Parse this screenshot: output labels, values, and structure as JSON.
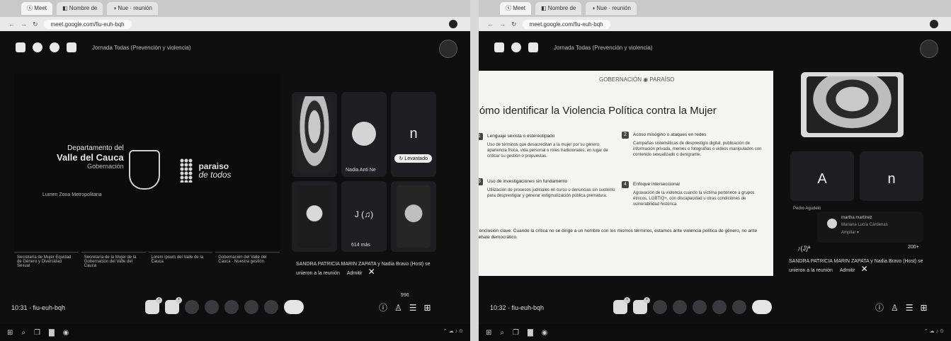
{
  "left": {
    "tabs": [
      "ⓢ Meet",
      "◧ Nombre de",
      "◑ Nue · reunión"
    ],
    "address": "meet.google.com/fiu-euh-bqh",
    "meeting_title": "Jornada Todas (Prevención y violencia)",
    "presentation": {
      "dept_line1": "Departamento del",
      "dept_line2": "Valle del Cauca",
      "dept_line3": "Gobernación",
      "brand_line1": "paraiso",
      "brand_line2": "de todos",
      "subline": "Lumen Zona Metropolitana",
      "captions": [
        "Secretaría de Mujer Equidad de Género y Diversidad Sexual",
        "Secretaría de la Mujer de la Gobernación del Valle del Cauca",
        "Lorem ipsum del Valle de la Cauca",
        "Gobernación del Valle del Cauca · Nuestra gestión"
      ]
    },
    "participants": {
      "tile2_name": "Nadia Anti Ne",
      "tile3_initial": "n",
      "pill": "↻ Levantado",
      "count_tile": "J (♫)",
      "count_label": "614 más"
    },
    "notification": "SANDRA PATRICIA MARIN ZAPATA y Nadia Bravo (Host) se unieron a la reunión",
    "notification_action": "Admitir",
    "clock": "10:31 · fiu-euh-bqh",
    "count_badge": "996"
  },
  "right": {
    "tabs": [
      "ⓢ Meet",
      "◧ Nombre de",
      "◑ Nue · reunión"
    ],
    "address": "meet.google.com/fiu-euh-bqh",
    "meeting_title": "Jornada Todas (Prevención y violencia)",
    "slide": {
      "title": "Cómo identificar la Violencia Política contra la Mujer",
      "logos": "GOBERNACIÓN  ◉  PARAÍSO",
      "items": [
        {
          "n": "1",
          "title": "Lenguaje sexista o estereotipado",
          "body": "Uso de términos que desacreditan a la mujer por su género, apariencia física, vida personal o roles tradicionales, en lugar de criticar su gestión o propuestas."
        },
        {
          "n": "2",
          "title": "Acoso misógino o ataques en redes",
          "body": "Campañas sistemáticas de desprestigio digital, publicación de información privada, memes o fotografías o videos manipulados con contenido sexualizado o denigrante."
        },
        {
          "n": "3",
          "title": "Uso de investigaciones sin fundamento",
          "body": "Utilización de procesos judiciales en curso o denuncias sin sustento para desprestigiar y generar estigmatización pública prematura."
        },
        {
          "n": "4",
          "title": "Enfoque interseccional",
          "body": "Agravación de la violencia cuando la víctima pertenece a grupos étnicos, LGBTIQ+, con discapacidad u otras condiciones de vulnerabilidad histórica."
        }
      ],
      "conclusion": "Conclusión clave: Cuando la crítica no se dirige a un hombre con los mismos términos, estamos ante violencia política de género, no ante debate democrático."
    },
    "participants": {
      "tile_initial_a": "A",
      "tile_initial_n": "n",
      "name_label": "Pedro Agudelo",
      "chat_name": "martha martínez",
      "chat_lines": "Mariana Lucía Cárdenas",
      "chat_line3": "Ampliar ▾",
      "reaction": "♪(J)ª",
      "count": "200+"
    },
    "notification": "SANDRA PATRICIA MARIN ZAPATA y Nadia Bravo (Host) se unieron a la reunión",
    "notification_action": "Admitir",
    "clock": "10:32 · fiu-euh-bqh"
  }
}
